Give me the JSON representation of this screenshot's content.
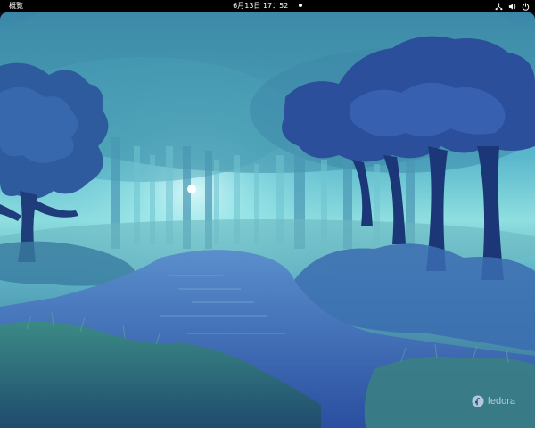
{
  "topbar": {
    "activities_label": "概覧",
    "clock_text": "6月13日  17：52"
  },
  "tray": {
    "icons": [
      "network-icon",
      "volume-icon",
      "power-icon"
    ]
  },
  "wallpaper": {
    "logo_text": "fedora",
    "colors": {
      "sky_light": "#7fd3e0",
      "sky_dark": "#2f6f9a",
      "tree_dark": "#1f3d8a",
      "water": "#2a4fa0",
      "grass": "#2c6a7a"
    }
  }
}
